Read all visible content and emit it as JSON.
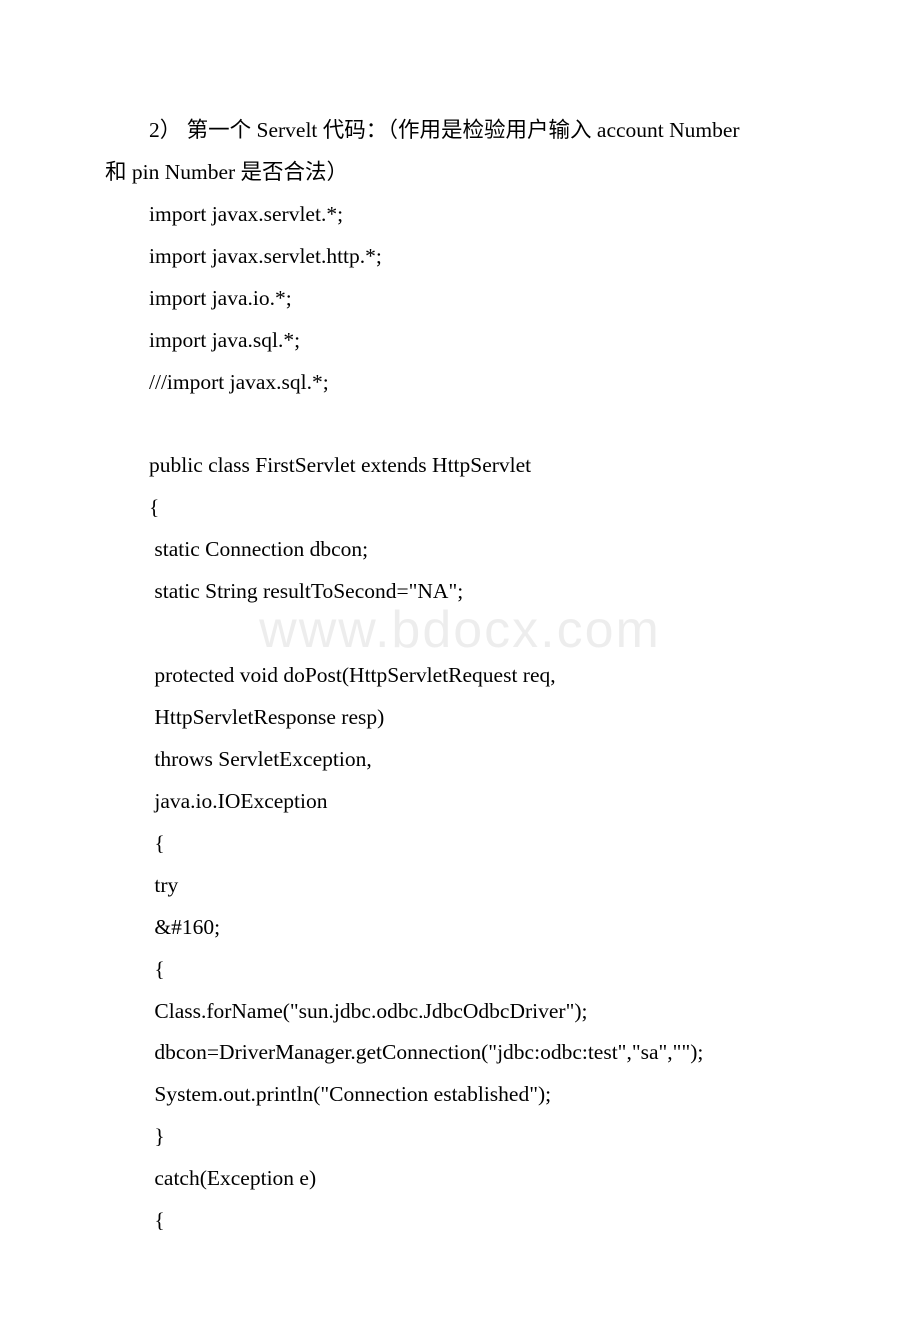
{
  "watermark": "www.bdocx.com",
  "lines": [
    {
      "type": "text",
      "indent": true,
      "text": "2） 第一个 Servelt 代码：（作用是检验用户输入 account Number"
    },
    {
      "type": "wrap",
      "text": "和 pin Number 是否合法）"
    },
    {
      "type": "text",
      "indent": true,
      "text": "import javax.servlet.*;"
    },
    {
      "type": "text",
      "indent": true,
      "text": "import javax.servlet.http.*;"
    },
    {
      "type": "text",
      "indent": true,
      "text": "import java.io.*;"
    },
    {
      "type": "text",
      "indent": true,
      "text": "import java.sql.*;"
    },
    {
      "type": "text",
      "indent": true,
      "text": "///import javax.sql.*;"
    },
    {
      "type": "blank"
    },
    {
      "type": "text",
      "indent": true,
      "text": "public class FirstServlet extends HttpServlet"
    },
    {
      "type": "text",
      "indent": true,
      "text": "{"
    },
    {
      "type": "text",
      "indent": true,
      "text": " static Connection dbcon;"
    },
    {
      "type": "text",
      "indent": true,
      "text": " static String resultToSecond=\"NA\";"
    },
    {
      "type": "blank"
    },
    {
      "type": "text",
      "indent": true,
      "text": " protected void doPost(HttpServletRequest req,"
    },
    {
      "type": "text",
      "indent": true,
      "text": " HttpServletResponse resp)"
    },
    {
      "type": "text",
      "indent": true,
      "text": " throws ServletException,"
    },
    {
      "type": "text",
      "indent": true,
      "text": " java.io.IOException"
    },
    {
      "type": "text",
      "indent": true,
      "text": " {"
    },
    {
      "type": "text",
      "indent": true,
      "text": " try"
    },
    {
      "type": "text",
      "indent": true,
      "text": " &#160;"
    },
    {
      "type": "text",
      "indent": true,
      "text": " {"
    },
    {
      "type": "text",
      "indent": true,
      "text": " Class.forName(\"sun.jdbc.odbc.JdbcOdbcDriver\");"
    },
    {
      "type": "text",
      "indent": true,
      "text": " dbcon=DriverManager.getConnection(\"jdbc:odbc:test\",\"sa\",\"\");"
    },
    {
      "type": "text",
      "indent": true,
      "text": " System.out.println(\"Connection established\");"
    },
    {
      "type": "text",
      "indent": true,
      "text": " }"
    },
    {
      "type": "text",
      "indent": true,
      "text": " catch(Exception e)"
    },
    {
      "type": "text",
      "indent": true,
      "text": " {"
    }
  ]
}
